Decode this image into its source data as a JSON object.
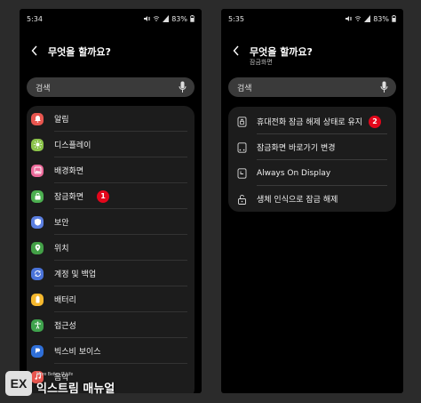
{
  "left": {
    "status": {
      "time": "5:34",
      "battery": "83%"
    },
    "title": "무엇을 할까요?",
    "search_text": "검색",
    "items": [
      {
        "label": "알림",
        "icon": "bell-icon",
        "color": "#e8564f"
      },
      {
        "label": "디스플레이",
        "icon": "sun-icon",
        "color": "#8bc34a"
      },
      {
        "label": "배경화면",
        "icon": "image-icon",
        "color": "#ec6a9a"
      },
      {
        "label": "잠금화면",
        "icon": "lock-icon",
        "color": "#4caf50"
      },
      {
        "label": "보안",
        "icon": "shield-icon",
        "color": "#5b7fe0"
      },
      {
        "label": "위치",
        "icon": "location-icon",
        "color": "#43a047"
      },
      {
        "label": "계정 및 백업",
        "icon": "sync-icon",
        "color": "#4a73d9"
      },
      {
        "label": "배터리",
        "icon": "battery-icon",
        "color": "#f5b82e"
      },
      {
        "label": "접근성",
        "icon": "accessibility-icon",
        "color": "#3fa34d"
      },
      {
        "label": "빅스비 보이스",
        "icon": "bixby-icon",
        "color": "#2f6fd8"
      },
      {
        "label": "음악",
        "icon": "music-icon",
        "color": "#e8564f"
      }
    ],
    "badge": "1"
  },
  "right": {
    "status": {
      "time": "5:35",
      "battery": "83%"
    },
    "title": "무엇을 할까요?",
    "subtitle": "잠금화면",
    "search_text": "검색",
    "items": [
      {
        "label": "휴대전화 잠금 해제 상태로 유지",
        "icon": "lock-phone-icon"
      },
      {
        "label": "잠금화면 바로가기 변경",
        "icon": "phone-shortcut-icon"
      },
      {
        "label": "Always On Display",
        "icon": "clock-icon"
      },
      {
        "label": "생체 인식으로 잠금 해제",
        "icon": "unlock-icon"
      }
    ],
    "badge": "2"
  },
  "watermark": {
    "logo": "EX",
    "tagline": "More Better IT Life",
    "name": "익스트림 매뉴얼"
  }
}
